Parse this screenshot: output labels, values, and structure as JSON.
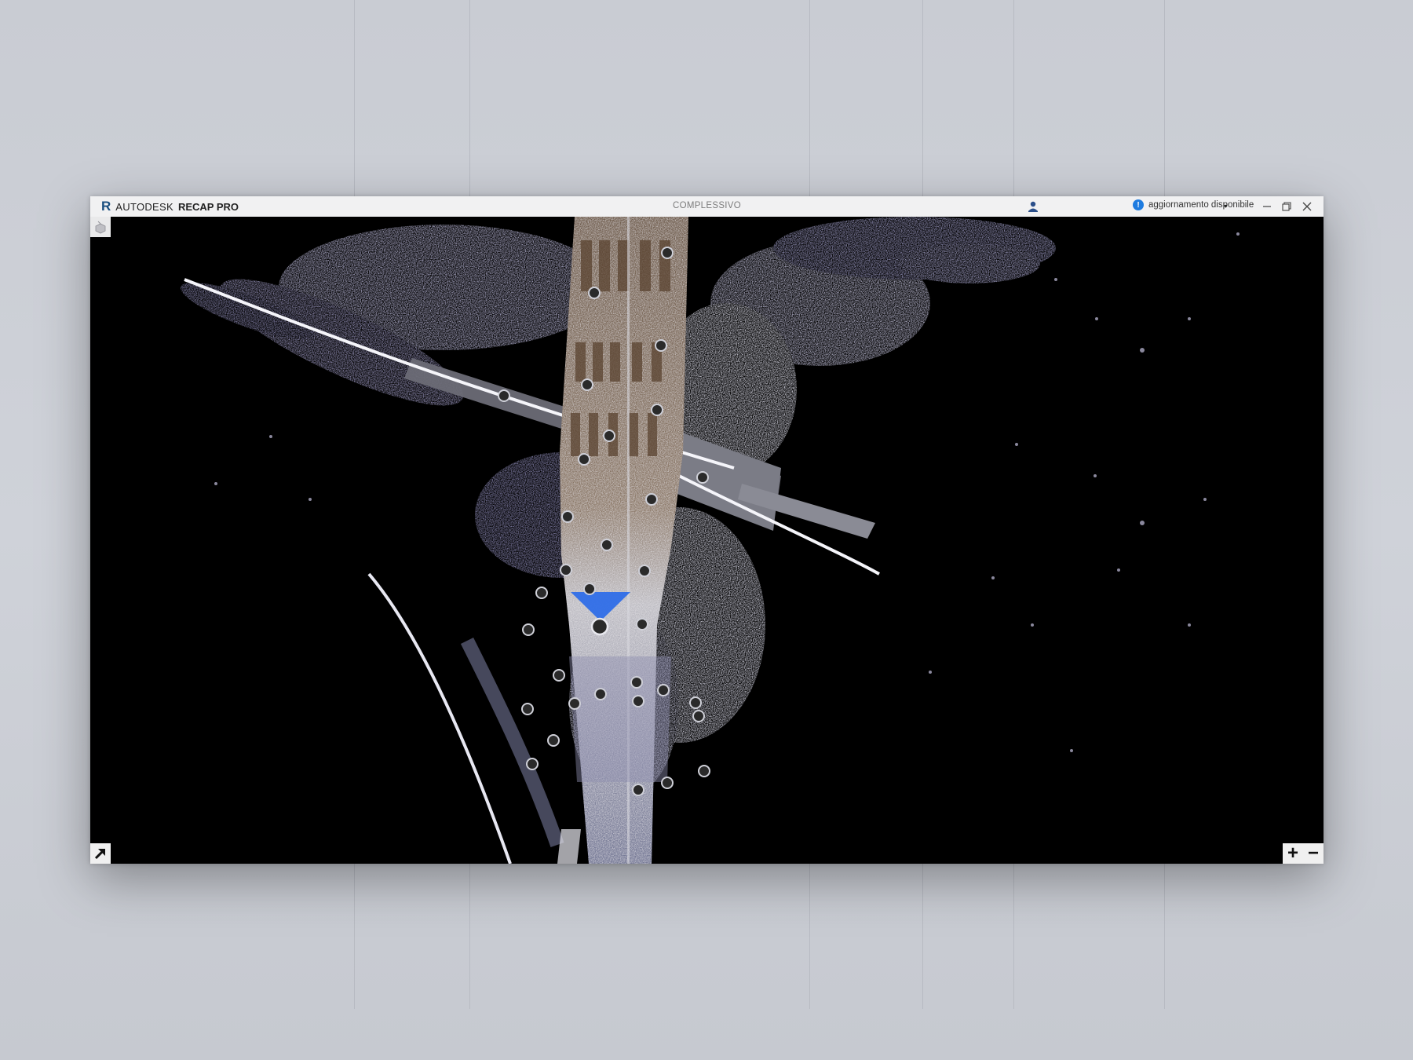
{
  "window": {
    "brand_name": "AUTODESK",
    "brand_product": "RECAP PRO",
    "title": "COMPLESSIVO",
    "update_text": "aggiornamento disponibile",
    "update_caret": "▾"
  },
  "zoom": {
    "in_label": "+",
    "out_label": "−"
  },
  "icons": {
    "logo": "recap-logo-icon",
    "user": "user-icon",
    "info": "info-icon",
    "minimize": "minimize-icon",
    "restore": "restore-icon",
    "close": "close-icon",
    "nav_cube": "navigation-cube-icon",
    "expand": "expand-arrow-icon"
  },
  "colors": {
    "titlebar": "#f1f1f2",
    "viewport": "#000000",
    "info_accent": "#1d7be0",
    "selected_scan": "#2f6ee8",
    "scan_marker": "#2a2a2a"
  }
}
